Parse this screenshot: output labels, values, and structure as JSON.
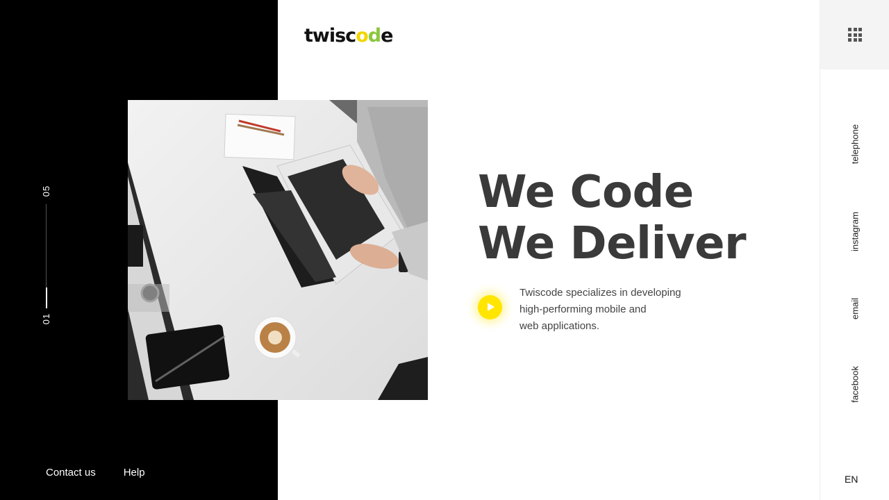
{
  "brand": {
    "logo_part1": "twisc",
    "logo_o1": "o",
    "logo_o2": "d",
    "logo_part2": "e"
  },
  "slider": {
    "total": "05",
    "current": "01",
    "progress": 0.2
  },
  "footer": {
    "contact_label": "Contact us",
    "help_label": "Help"
  },
  "hero": {
    "title_line1": "We Code",
    "title_line2": "We Deliver",
    "description_lines": [
      "Twiscode specializes in developing",
      "high-performing mobile and",
      "web applications."
    ]
  },
  "sidebar": {
    "menu_icon": "grid-menu-icon",
    "social_links": [
      "telephone",
      "instagram",
      "email",
      "facebook"
    ],
    "language": "EN"
  },
  "colors": {
    "accent": "#ffe500",
    "dark_panel": "#000000",
    "heading": "#3a3a3a"
  }
}
